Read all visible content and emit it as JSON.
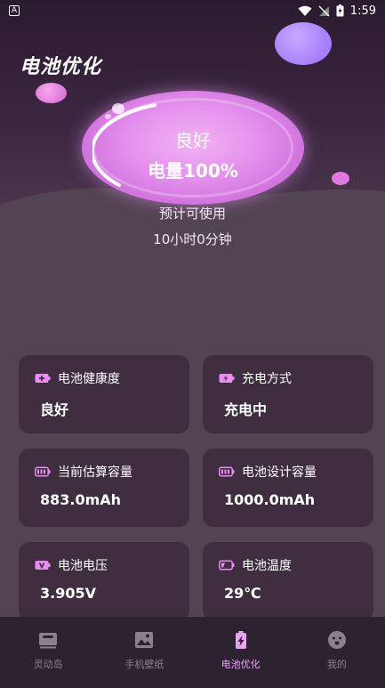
{
  "status_bar": {
    "left_icon": "A",
    "time": "1:59",
    "icons": [
      "wifi-icon",
      "signal-off-icon",
      "battery-charging-icon"
    ]
  },
  "page": {
    "title": "电池优化"
  },
  "orb": {
    "status": "良好",
    "level_text": "电量100%",
    "level_fraction": 1.0
  },
  "usage": {
    "label": "预计可使用",
    "value": "10小时0分钟"
  },
  "cards": [
    {
      "label": "电池健康度",
      "value": "良好",
      "icon": "battery-plus-icon"
    },
    {
      "label": "充电方式",
      "value": "充电中",
      "icon": "battery-charging-icon"
    },
    {
      "label": "当前估算容量",
      "value": "883.0mAh",
      "icon": "battery-level-icon"
    },
    {
      "label": "电池设计容量",
      "value": "1000.0mAh",
      "icon": "battery-level-icon"
    },
    {
      "label": "电池电压",
      "value": "3.905V",
      "icon": "battery-voltage-icon"
    },
    {
      "label": "电池温度",
      "value": "29℃",
      "icon": "battery-temperature-icon"
    }
  ],
  "nav": [
    {
      "label": "灵动岛",
      "icon": "dynamic-island-icon",
      "active": false
    },
    {
      "label": "手机壁纸",
      "icon": "wallpaper-icon",
      "active": false
    },
    {
      "label": "电池优化",
      "icon": "battery-bolt-icon",
      "active": true
    },
    {
      "label": "我的",
      "icon": "face-icon",
      "active": false
    }
  ],
  "colors": {
    "accent": "#e8a3f3",
    "card_bg": "#3e2e40",
    "page_bg": "#524452",
    "icon_pink": "#e88ef0",
    "nav_inactive": "#8d7f90"
  }
}
